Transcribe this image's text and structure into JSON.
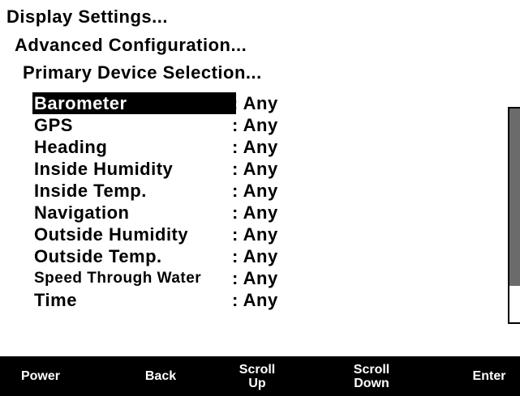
{
  "breadcrumbs": [
    "Display Settings...",
    "Advanced Configuration...",
    "Primary Device Selection..."
  ],
  "rows": [
    {
      "label": "Barometer",
      "value": ": Any",
      "selected": true
    },
    {
      "label": "GPS",
      "value": ": Any"
    },
    {
      "label": "Heading",
      "value": ": Any"
    },
    {
      "label": "Inside Humidity",
      "value": ": Any"
    },
    {
      "label": "Inside Temp.",
      "value": ": Any"
    },
    {
      "label": "Navigation",
      "value": ": Any"
    },
    {
      "label": "Outside Humidity",
      "value": ": Any"
    },
    {
      "label": "Outside Temp.",
      "value": ": Any"
    },
    {
      "label": "Speed Through Water",
      "value": ": Any"
    },
    {
      "label": "Time",
      "value": ": Any"
    }
  ],
  "softkeys": {
    "power": "Power",
    "back": "Back",
    "scroll_up": "Scroll\nUp",
    "scroll_down": "Scroll\nDown",
    "enter": "Enter"
  },
  "scroll": {
    "visible_fraction": 0.83
  },
  "colors": {
    "background": "#ffffff",
    "foreground": "#000000",
    "scroll_thumb": "#6b6b6b"
  }
}
